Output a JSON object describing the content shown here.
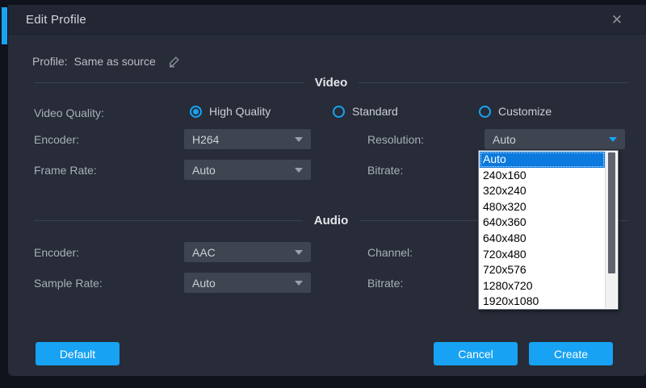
{
  "window": {
    "title": "Edit Profile",
    "close_glyph": "✕"
  },
  "profile": {
    "label": "Profile:",
    "value": "Same as source"
  },
  "video": {
    "section_title": "Video",
    "quality_label": "Video Quality:",
    "quality_options": [
      {
        "label": "High Quality",
        "selected": true
      },
      {
        "label": "Standard",
        "selected": false
      },
      {
        "label": "Customize",
        "selected": false
      }
    ],
    "encoder_label": "Encoder:",
    "encoder_value": "H264",
    "frame_rate_label": "Frame Rate:",
    "frame_rate_value": "Auto",
    "resolution_label": "Resolution:",
    "resolution_value": "Auto",
    "bitrate_label": "Bitrate:"
  },
  "audio": {
    "section_title": "Audio",
    "encoder_label": "Encoder:",
    "encoder_value": "AAC",
    "sample_rate_label": "Sample Rate:",
    "sample_rate_value": "Auto",
    "channel_label": "Channel:",
    "bitrate_label": "Bitrate:"
  },
  "resolution_dropdown": {
    "selected_index": 0,
    "options": [
      "Auto",
      "240x160",
      "320x240",
      "480x320",
      "640x360",
      "640x480",
      "720x480",
      "720x576",
      "1280x720",
      "1920x1080"
    ]
  },
  "footer": {
    "default_label": "Default",
    "cancel_label": "Cancel",
    "create_label": "Create"
  },
  "colors": {
    "accent_blue": "#18a3f2",
    "list_highlight": "#0b79dd",
    "dialog_body": "#272c38",
    "title_bar": "#232734",
    "dropdown_bg": "#3e4450",
    "button_blue": "#17a2f3"
  }
}
